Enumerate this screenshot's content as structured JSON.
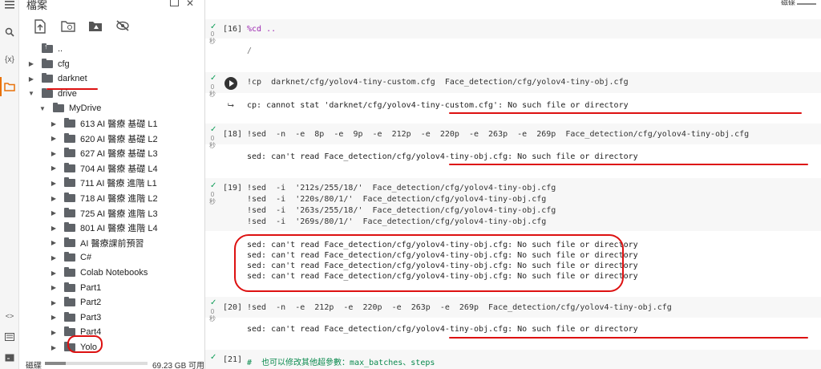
{
  "rail": {
    "icons": [
      "menu-icon",
      "search-icon",
      "variables-icon",
      "folder-icon",
      "code-icon",
      "terminal-icon",
      "keyboard-icon"
    ],
    "variables_label": "{x}",
    "code_label": "<>"
  },
  "files": {
    "title": "檔案",
    "toolbar": [
      "upload-icon",
      "refresh-folder-icon",
      "drive-icon",
      "hide-icon"
    ],
    "tree": [
      {
        "label": "..",
        "level": 0,
        "arrow": ""
      },
      {
        "label": "cfg",
        "level": 0,
        "arrow": "▶"
      },
      {
        "label": "darknet",
        "level": 0,
        "arrow": "▶"
      },
      {
        "label": "drive",
        "level": 0,
        "arrow": "▼"
      },
      {
        "label": "MyDrive",
        "level": 1,
        "arrow": "▼"
      },
      {
        "label": "613 AI 醫療 基礎 L1",
        "level": 2,
        "arrow": "▶"
      },
      {
        "label": "620 AI 醫療 基礎 L2",
        "level": 2,
        "arrow": "▶"
      },
      {
        "label": "627 AI 醫療 基礎 L3",
        "level": 2,
        "arrow": "▶"
      },
      {
        "label": "704 AI 醫療 基礎 L4",
        "level": 2,
        "arrow": "▶"
      },
      {
        "label": "711 AI 醫療 進階 L1",
        "level": 2,
        "arrow": "▶"
      },
      {
        "label": "718 AI 醫療 進階 L2",
        "level": 2,
        "arrow": "▶"
      },
      {
        "label": "725 AI 醫療 進階 L3",
        "level": 2,
        "arrow": "▶"
      },
      {
        "label": "801 AI 醫療 進階 L4",
        "level": 2,
        "arrow": "▶"
      },
      {
        "label": "AI 醫療課前預習",
        "level": 2,
        "arrow": "▶"
      },
      {
        "label": "C#",
        "level": 2,
        "arrow": "▶"
      },
      {
        "label": "Colab Notebooks",
        "level": 2,
        "arrow": "▶"
      },
      {
        "label": "Part1",
        "level": 2,
        "arrow": "▶"
      },
      {
        "label": "Part2",
        "level": 2,
        "arrow": "▶"
      },
      {
        "label": "Part3",
        "level": 2,
        "arrow": "▶"
      },
      {
        "label": "Part4",
        "level": 2,
        "arrow": "▶"
      },
      {
        "label": "Yolo",
        "level": 2,
        "arrow": "▶"
      }
    ],
    "disk_label": "磁碟",
    "disk_usage_fraction": 0.2,
    "disk_value": "69.23 GB 可用"
  },
  "notebook": {
    "topbar_label": "磁碟",
    "cells": [
      {
        "prompt": "[16]",
        "code": "%cd ..",
        "output": "/"
      },
      {
        "prompt": "",
        "code": "!cp  darknet/cfg/yolov4-tiny-custom.cfg  Face_detection/cfg/yolov4-tiny-obj.cfg",
        "output": "cp: cannot stat 'darknet/cfg/yolov4-tiny-custom.cfg': No such file or directory"
      },
      {
        "prompt": "[18]",
        "code": "!sed  -n  -e  8p  -e  9p  -e  212p  -e  220p  -e  263p  -e  269p  Face_detection/cfg/yolov4-tiny-obj.cfg",
        "output": "sed: can't read Face_detection/cfg/yolov4-tiny-obj.cfg: No such file or directory"
      },
      {
        "prompt": "[19]",
        "code_lines": [
          "!sed  -i  '212s/255/18/'  Face_detection/cfg/yolov4-tiny-obj.cfg",
          "!sed  -i  '220s/80/1/'  Face_detection/cfg/yolov4-tiny-obj.cfg",
          "!sed  -i  '263s/255/18/'  Face_detection/cfg/yolov4-tiny-obj.cfg",
          "!sed  -i  '269s/80/1/'  Face_detection/cfg/yolov4-tiny-obj.cfg"
        ],
        "output_lines": [
          "sed: can't read Face_detection/cfg/yolov4-tiny-obj.cfg: No such file or directory",
          "sed: can't read Face_detection/cfg/yolov4-tiny-obj.cfg: No such file or directory",
          "sed: can't read Face_detection/cfg/yolov4-tiny-obj.cfg: No such file or directory",
          "sed: can't read Face_detection/cfg/yolov4-tiny-obj.cfg: No such file or directory"
        ]
      },
      {
        "prompt": "[20]",
        "code": "!sed  -n  -e  212p  -e  220p  -e  263p  -e  269p  Face_detection/cfg/yolov4-tiny-obj.cfg",
        "output": "sed: can't read Face_detection/cfg/yolov4-tiny-obj.cfg: No such file or directory"
      },
      {
        "prompt": "[21]",
        "code": "#  也可以修改其他超參數：max_batches、steps"
      }
    ],
    "secs_label": "0\n秒"
  },
  "colors": {
    "annotation": "#dd1111",
    "accent": "#e8710a",
    "ok": "#0f9d58"
  }
}
